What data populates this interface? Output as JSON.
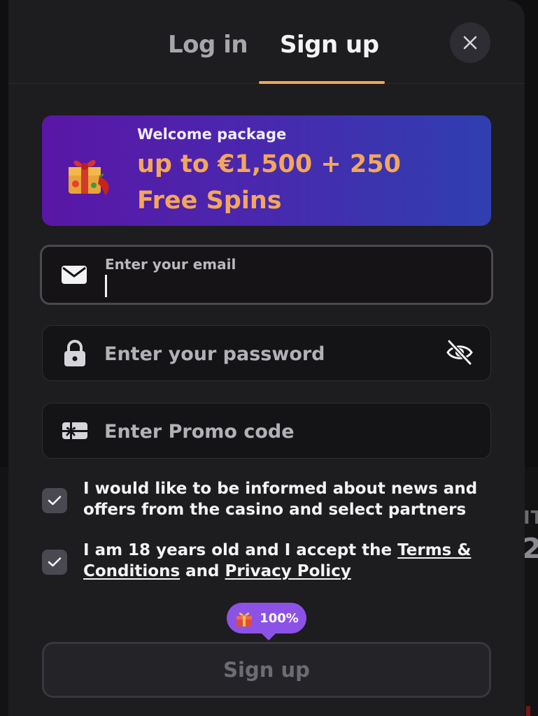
{
  "background_page": {
    "text_1": "IT",
    "text_2": "2"
  },
  "tabs": {
    "login": "Log in",
    "signup": "Sign up",
    "active": "signup"
  },
  "close_icon": "close-icon",
  "banner": {
    "title": "Welcome package",
    "amount": "up to €1,500 + 250 Free Spins",
    "icon": "gift-icon"
  },
  "form": {
    "email": {
      "label": "Enter your email",
      "value": "",
      "icon": "mail-icon"
    },
    "password": {
      "placeholder": "Enter your password",
      "icon": "lock-icon",
      "toggle_icon": "eye-off-icon"
    },
    "promo": {
      "placeholder": "Enter Promo code",
      "icon": "promo-card-icon"
    }
  },
  "consents": [
    {
      "checked": true,
      "text": "I would like to be informed about news and offers from the casino and select partners"
    },
    {
      "checked": true,
      "text_prefix": "I am 18 years old and I accept the ",
      "terms_link": "Terms & Conditions",
      "text_middle": " and ",
      "privacy_link": "Privacy Policy"
    }
  ],
  "bonus_pill": {
    "icon": "gift-icon",
    "text": "100%"
  },
  "submit": {
    "label": "Sign up",
    "enabled": false
  },
  "colors": {
    "accent": "#f0a84d",
    "banner_amount": "#f4a65a",
    "pill": "#8c52e6",
    "modal_bg": "#1d1c1f"
  }
}
